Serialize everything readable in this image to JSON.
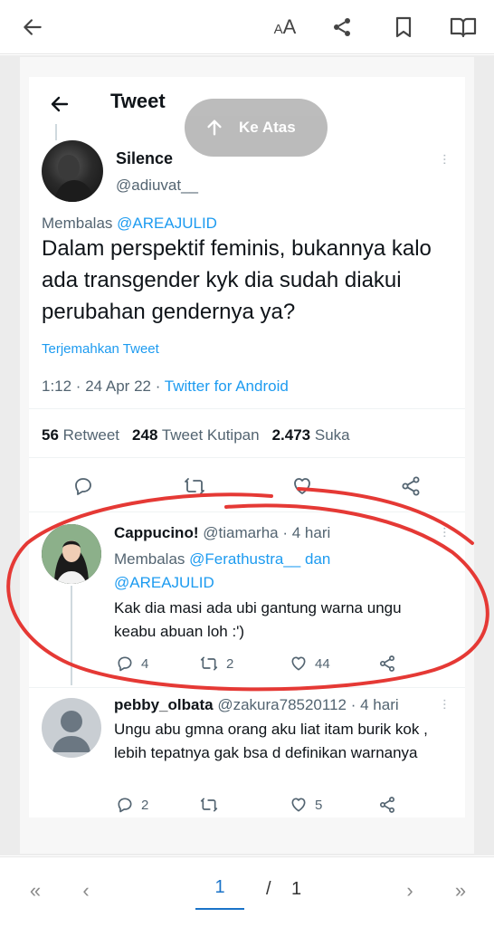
{
  "toolbar": {
    "text_size_label": "AA",
    "icons": [
      "back-arrow-icon",
      "text-size-icon",
      "share-icon",
      "bookmark-icon",
      "reader-mode-icon"
    ]
  },
  "tweet_header": {
    "title": "Tweet"
  },
  "scroll_top": {
    "label": "Ke Atas"
  },
  "main_tweet": {
    "name": "Silence",
    "handle": "@adiuvat__",
    "reply_prefix": "Membalas",
    "reply_to": "@AREAJULID",
    "text": "Dalam perspektif feminis, bukannya kalo ada transgender kyk dia sudah diakui perubahan gendernya ya?",
    "translate": "Terjemahkan Tweet",
    "time": "1:12 · 24 Apr 22 ·",
    "source": "Twitter for Android",
    "retweets": "56",
    "retweets_label": "Retweet",
    "quotes": "248",
    "quotes_label": "Tweet Kutipan",
    "likes": "2.473",
    "likes_label": "Suka"
  },
  "replies": [
    {
      "name": "Cappucino!",
      "handle": "@tiamarha",
      "age": "· 4 hari",
      "reply_prefix": "Membalas",
      "reply_to_1": "@Ferathustra__",
      "reply_and": "dan",
      "reply_to_2": "@AREAJULID",
      "text": "Kak dia masi ada ubi gantung warna ungu keabu abuan loh :')",
      "replies": "4",
      "retweets": "2",
      "likes": "44"
    },
    {
      "name": "pebby_olbata",
      "handle": "@zakura78520112",
      "age": "· 4 hari",
      "text": "Ungu abu gmna orang aku liat itam burik kok , lebih tepatnya gak bsa d definikan warnanya",
      "replies": "2",
      "retweets": "",
      "likes": "5"
    }
  ],
  "pager": {
    "current": "1",
    "separator": "/",
    "total": "1"
  },
  "colors": {
    "link": "#1d9bf0",
    "annotation": "#e53935",
    "muted": "#536471"
  }
}
